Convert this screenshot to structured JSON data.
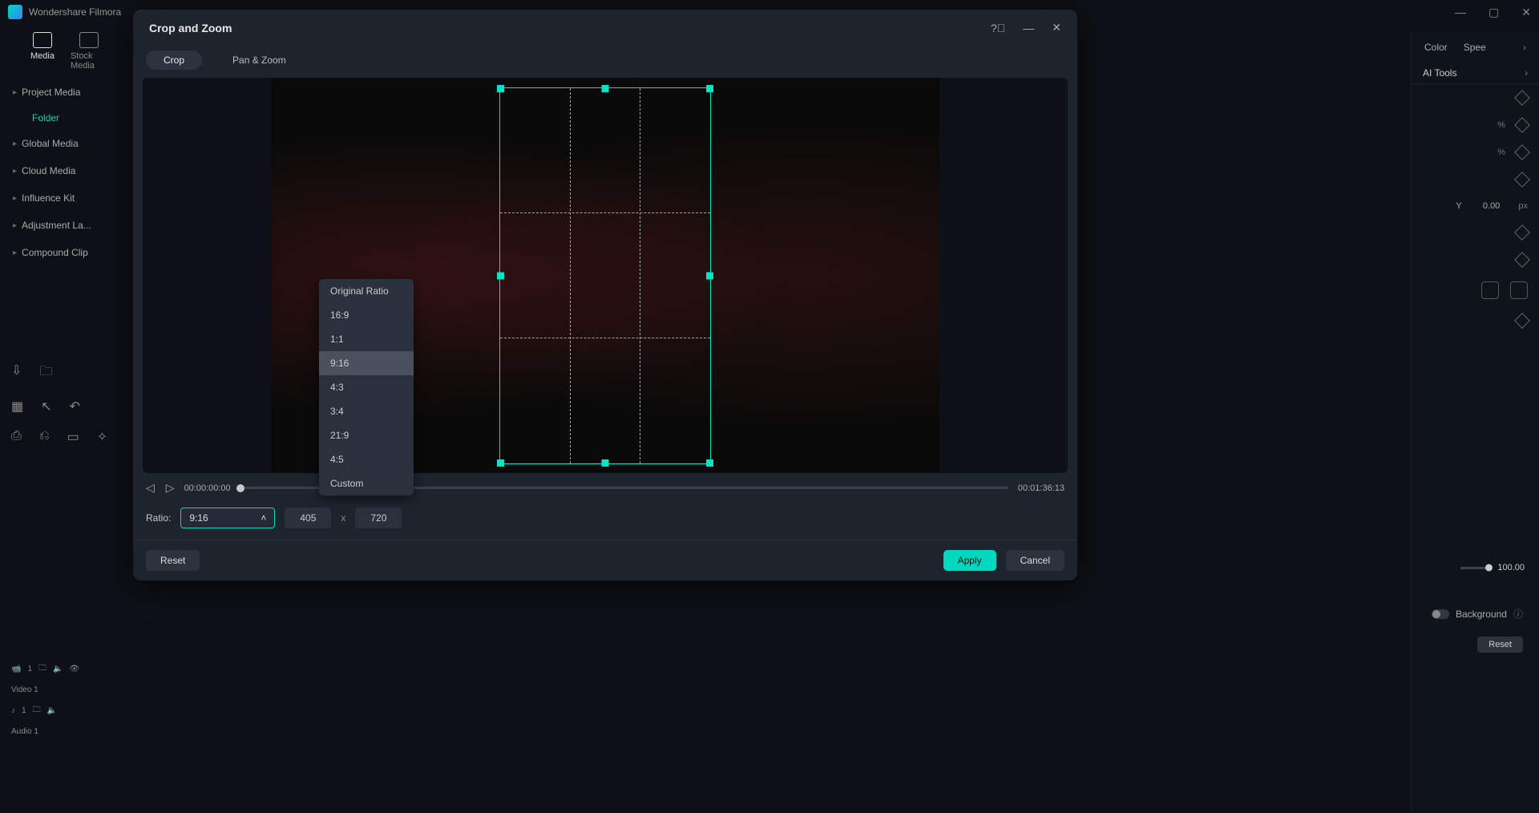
{
  "app": {
    "title": "Wondershare Filmora"
  },
  "dialog": {
    "title": "Crop and Zoom",
    "tabs": {
      "crop": "Crop",
      "pan_zoom": "Pan & Zoom"
    },
    "time_current": "00:00:00:00",
    "time_total": "00:01:36:13",
    "ratio_label": "Ratio:",
    "ratio_value": "9:16",
    "width": "405",
    "height": "720",
    "reset": "Reset",
    "apply": "Apply",
    "cancel": "Cancel"
  },
  "ratio_options": {
    "o0": "Original Ratio",
    "o1": "16:9",
    "o2": "1:1",
    "o3": "9:16",
    "o4": "4:3",
    "o5": "3:4",
    "o6": "21:9",
    "o7": "4:5",
    "o8": "Custom"
  },
  "sidebar": {
    "tab_media": "Media",
    "tab_stock": "Stock Media",
    "project_media": "Project Media",
    "folder": "Folder",
    "global_media": "Global Media",
    "cloud_media": "Cloud Media",
    "influence_kit": "Influence Kit",
    "adjustment_layer": "Adjustment La...",
    "compound_clip": "Compound Clip"
  },
  "right": {
    "tab_color": "Color",
    "tab_speed": "Spee",
    "ai_tools": "AI Tools",
    "unit_percent": "%",
    "unit_px": "px",
    "y_label": "Y",
    "y_value": "0.00",
    "slider_value": "100.00",
    "background": "Background",
    "reset": "Reset"
  },
  "tracks": {
    "video": "Video 1",
    "audio": "Audio 1"
  }
}
